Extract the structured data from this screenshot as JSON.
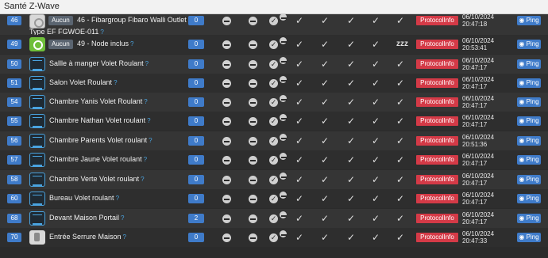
{
  "window": {
    "title": "Santé Z-Wave"
  },
  "labels": {
    "protocol_button": "ProtocolInfo",
    "ping_button": "Ping",
    "aucun_badge": "Aucun",
    "sleep": "zzz"
  },
  "rows": [
    {
      "id": "46",
      "name": "46 - Fibargroup Fibaro Walli Outlet",
      "name_line2": "Type EF FGWOE-011",
      "icon": "fibaro",
      "aucun": true,
      "count": "0",
      "date": "06/10/2024",
      "time": "20:47:18",
      "sleep": false
    },
    {
      "id": "49",
      "name": "49 - Node inclus",
      "icon": "green",
      "aucun": true,
      "count": "0",
      "date": "06/10/2024",
      "time": "20:53:41",
      "sleep": true
    },
    {
      "id": "50",
      "name": "Sallle à manger Volet Roulant",
      "icon": "blind",
      "count": "0",
      "date": "06/10/2024",
      "time": "20:47:17"
    },
    {
      "id": "51",
      "name": "Salon Volet Roulant",
      "icon": "blind",
      "count": "0",
      "date": "06/10/2024",
      "time": "20:47:17"
    },
    {
      "id": "54",
      "name": "Chambre Yanis Volet Roulant",
      "icon": "blind",
      "count": "0",
      "date": "06/10/2024",
      "time": "20:47:17"
    },
    {
      "id": "55",
      "name": "Chambre Nathan Volet roulant",
      "icon": "blind",
      "count": "0",
      "date": "06/10/2024",
      "time": "20:47:17"
    },
    {
      "id": "56",
      "name": "Chambre Parents Volet roulant",
      "icon": "blind",
      "count": "0",
      "date": "06/10/2024",
      "time": "20:51:36"
    },
    {
      "id": "57",
      "name": "Chambre Jaune Volet roulant",
      "icon": "blind",
      "count": "0",
      "date": "06/10/2024",
      "time": "20:47:17"
    },
    {
      "id": "58",
      "name": "Chambre Verte Volet roulant",
      "icon": "blind",
      "count": "0",
      "date": "06/10/2024",
      "time": "20:47:17"
    },
    {
      "id": "60",
      "name": "Bureau Volet roulant",
      "icon": "blind",
      "count": "0",
      "date": "06/10/2024",
      "time": "20:47:17"
    },
    {
      "id": "68",
      "name": "Devant Maison Portail",
      "icon": "blind",
      "count": "2",
      "date": "06/10/2024",
      "time": "20:47:17"
    },
    {
      "id": "70",
      "name": "Entrée Serrure Maison",
      "icon": "lock",
      "count": "0",
      "date": "06/10/2024",
      "time": "20:47:33"
    }
  ]
}
